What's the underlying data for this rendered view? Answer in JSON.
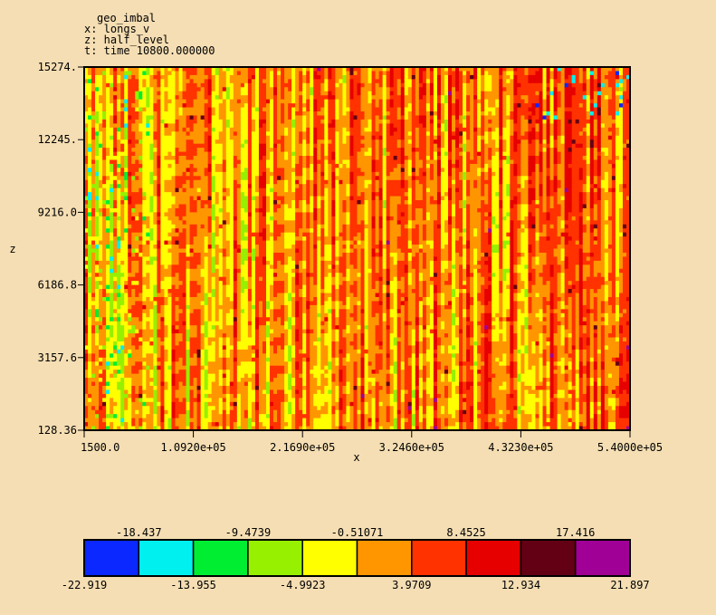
{
  "header": {
    "title": "geo_imbal",
    "x_desc": "x: longs_v",
    "z_desc": "z: half_level",
    "t_desc": "t: time 10800.000000"
  },
  "chart_data": {
    "type": "heatmap",
    "title": "geo_imbal",
    "xlabel": "x",
    "ylabel": "z",
    "x_tick_labels": [
      "1500.0",
      "1.0920e+05",
      "2.1690e+05",
      "3.2460e+05",
      "4.3230e+05",
      "5.4000e+05"
    ],
    "y_tick_labels": [
      "128.36",
      "3157.6",
      "6186.8",
      "9216.0",
      "12245.",
      "15274."
    ],
    "xlim": [
      1500.0,
      540000.0
    ],
    "ylim": [
      128.36,
      15274.0
    ],
    "grid": false,
    "colorbar": {
      "min": -22.919,
      "max": 21.897,
      "labels_bottom": [
        "-22.919",
        "-13.955",
        "-4.9923",
        "3.9709",
        "12.934",
        "21.897"
      ],
      "labels_top": [
        "-18.437",
        "-9.4739",
        "-0.51071",
        "8.4525",
        "17.416"
      ],
      "colors": [
        "#0a28ff",
        "#00f0f0",
        "#00ee32",
        "#96f000",
        "#ffff00",
        "#ff9600",
        "#ff3200",
        "#e60000",
        "#640014",
        "#a00096"
      ]
    }
  }
}
